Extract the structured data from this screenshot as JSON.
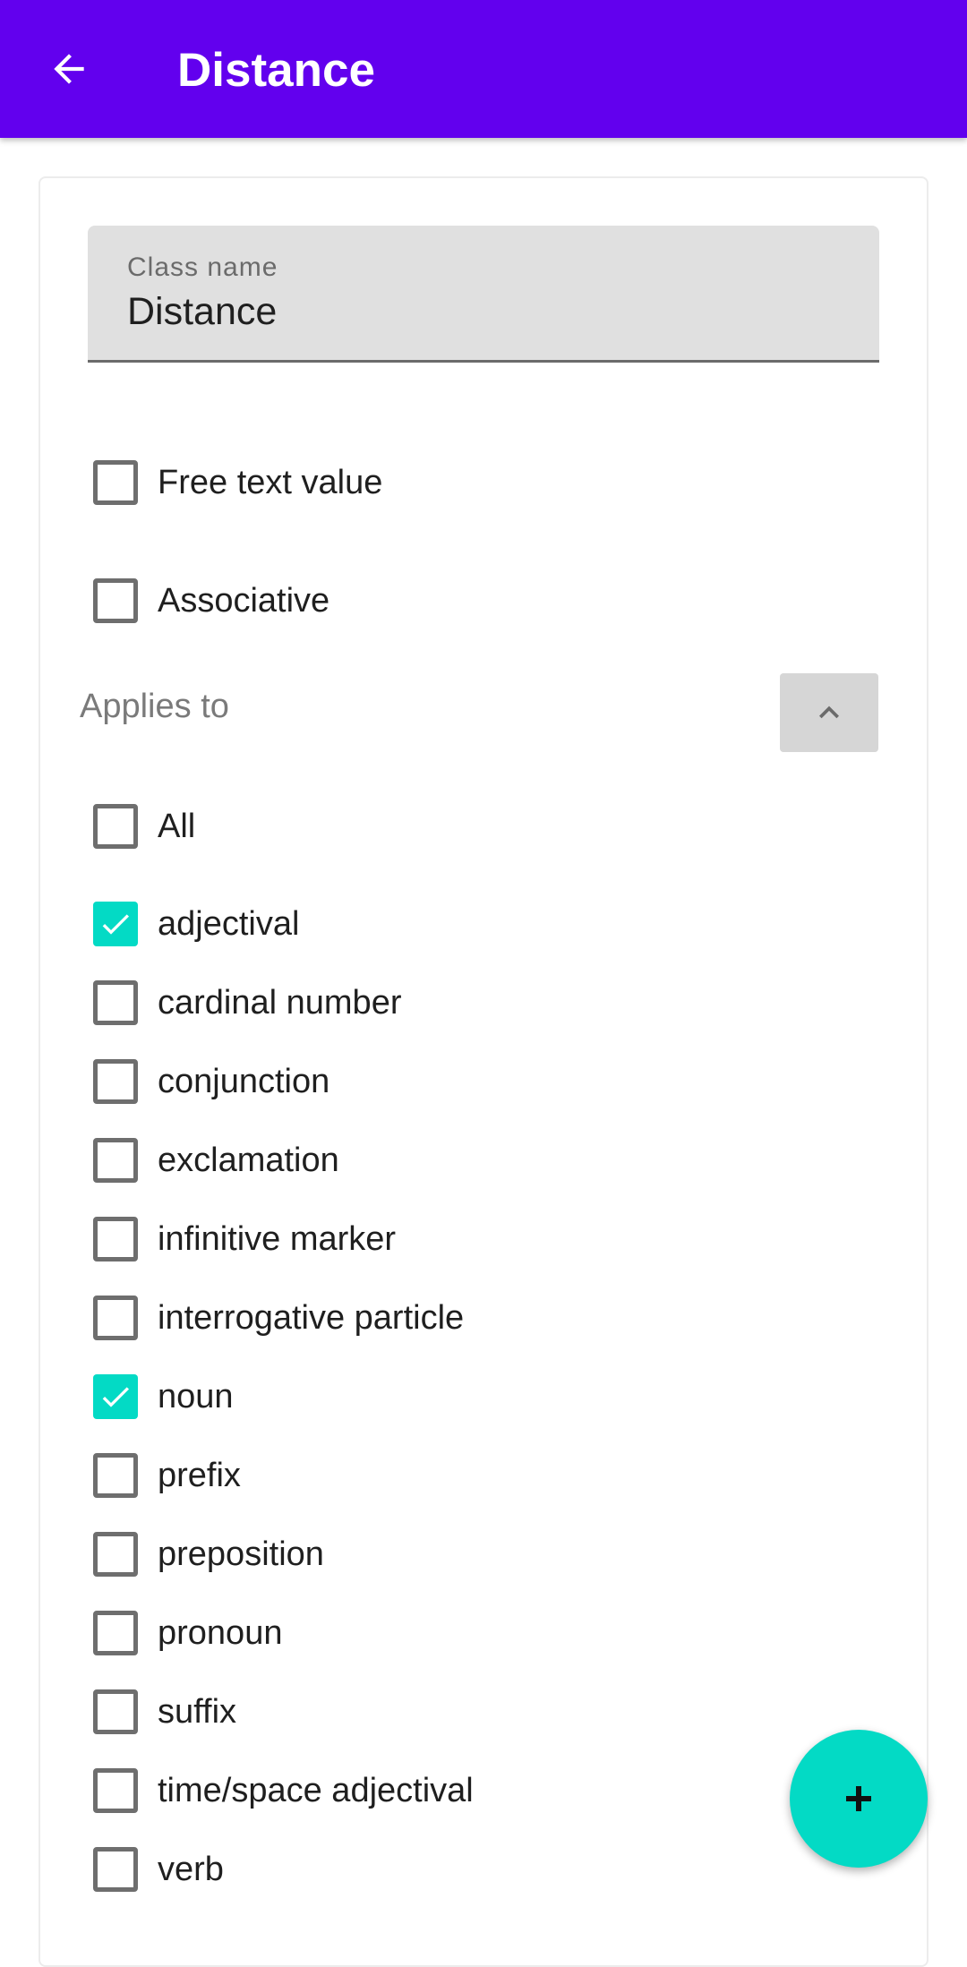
{
  "appbar": {
    "title": "Distance",
    "back_icon": "arrow-left-icon",
    "background_color": "#6200ee"
  },
  "form": {
    "class_name": {
      "label": "Class name",
      "value": "Distance"
    },
    "free_text_value": {
      "label": "Free text value",
      "checked": false
    },
    "associative": {
      "label": "Associative",
      "checked": false
    },
    "applies_to": {
      "label": "Applies to",
      "toggle_icon": "chevron-up-icon",
      "all": {
        "label": "All",
        "checked": false
      },
      "items": [
        {
          "label": "adjectival",
          "checked": true
        },
        {
          "label": "cardinal number",
          "checked": false
        },
        {
          "label": "conjunction",
          "checked": false
        },
        {
          "label": "exclamation",
          "checked": false
        },
        {
          "label": "infinitive marker",
          "checked": false
        },
        {
          "label": "interrogative particle",
          "checked": false
        },
        {
          "label": "noun",
          "checked": true
        },
        {
          "label": "prefix",
          "checked": false
        },
        {
          "label": "preposition",
          "checked": false
        },
        {
          "label": "pronoun",
          "checked": false
        },
        {
          "label": "suffix",
          "checked": false
        },
        {
          "label": "time/space adjectival",
          "checked": false
        },
        {
          "label": "verb",
          "checked": false
        }
      ]
    }
  },
  "fab": {
    "icon": "plus-icon",
    "color": "#03dac5"
  },
  "colors": {
    "checkbox_checked": "#03dac5"
  }
}
